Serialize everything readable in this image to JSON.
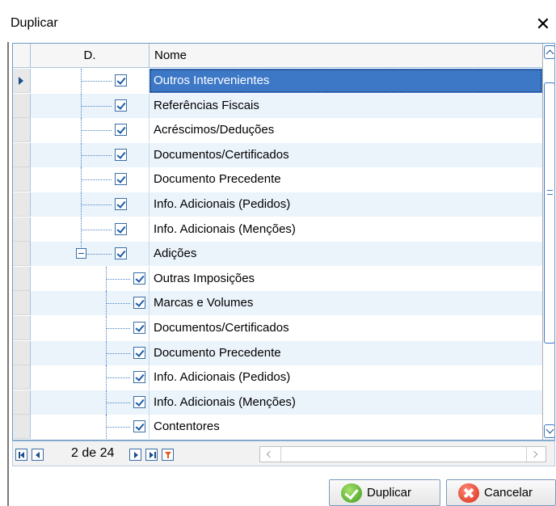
{
  "window": {
    "title": "Duplicar",
    "close_glyph": "✕"
  },
  "grid": {
    "columns": [
      "D.",
      "Nome"
    ],
    "rows": [
      {
        "label": "Outros Intervenientes",
        "level": 1,
        "checked": true,
        "selected": true
      },
      {
        "label": "Referências Fiscais",
        "level": 1,
        "checked": true
      },
      {
        "label": "Acréscimos/Deduções",
        "level": 1,
        "checked": true
      },
      {
        "label": "Documentos/Certificados",
        "level": 1,
        "checked": true
      },
      {
        "label": "Documento Precedente",
        "level": 1,
        "checked": true
      },
      {
        "label": "Info. Adicionais (Pedidos)",
        "level": 1,
        "checked": true
      },
      {
        "label": "Info. Adicionais (Menções)",
        "level": 1,
        "checked": true
      },
      {
        "label": "Adições",
        "level": 1,
        "checked": true,
        "expanded": true
      },
      {
        "label": "Outras Imposições",
        "level": 2,
        "checked": true
      },
      {
        "label": "Marcas e Volumes",
        "level": 2,
        "checked": true
      },
      {
        "label": "Documentos/Certificados",
        "level": 2,
        "checked": true
      },
      {
        "label": "Documento Precedente",
        "level": 2,
        "checked": true
      },
      {
        "label": "Info. Adicionais (Pedidos)",
        "level": 2,
        "checked": true
      },
      {
        "label": "Info. Adicionais (Menções)",
        "level": 2,
        "checked": true
      },
      {
        "label": "Contentores",
        "level": 2,
        "checked": true
      }
    ]
  },
  "navigator": {
    "page_text": "2 de 24"
  },
  "buttons": {
    "duplicate": "Duplicar",
    "cancel": "Cancelar"
  },
  "colors": {
    "selection": "#3d78c7",
    "alt_row": "#ebf3fb",
    "grid_border": "#6d9ec8"
  },
  "icons": {
    "close": "close-icon",
    "checkbox": "checkbox-checked-icon",
    "collapse": "minus-expander-icon",
    "first": "first-record-icon",
    "prev": "prev-record-icon",
    "next": "next-record-icon",
    "last": "last-record-icon",
    "filter": "filter-icon",
    "ok": "ok-check-icon",
    "cancel": "cancel-x-icon"
  }
}
